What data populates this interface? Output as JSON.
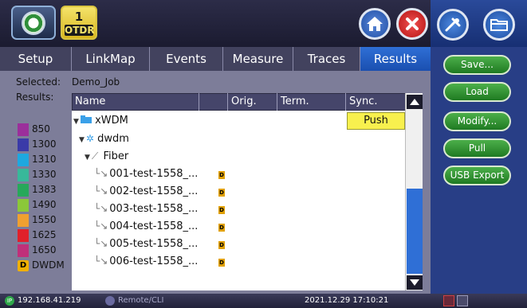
{
  "header": {
    "otdr_number": "1",
    "otdr_label": "OTDR"
  },
  "tabs": [
    {
      "label": "Setup"
    },
    {
      "label": "LinkMap"
    },
    {
      "label": "Events"
    },
    {
      "label": "Measure"
    },
    {
      "label": "Traces"
    },
    {
      "label": "Results",
      "active": true
    }
  ],
  "info": {
    "selected_label": "Selected:",
    "selected_value": "Demo_Job",
    "results_label": "Results:"
  },
  "legend": [
    {
      "label": "850",
      "color": "#9b2f9b"
    },
    {
      "label": "1300",
      "color": "#3a3aa8"
    },
    {
      "label": "1310",
      "color": "#1ea8e0"
    },
    {
      "label": "1330",
      "color": "#38b89a"
    },
    {
      "label": "1383",
      "color": "#27a85a"
    },
    {
      "label": "1490",
      "color": "#8bc83a"
    },
    {
      "label": "1550",
      "color": "#f0a030"
    },
    {
      "label": "1625",
      "color": "#e0202a"
    },
    {
      "label": "1650",
      "color": "#c0307a"
    },
    {
      "label": "DWDM",
      "badge": "D"
    }
  ],
  "table": {
    "columns": [
      "Name",
      "Orig.",
      "Term.",
      "Sync."
    ],
    "push_label": "Push",
    "rows": [
      {
        "label": "xWDM"
      },
      {
        "label": "dwdm"
      },
      {
        "label": "Fiber"
      },
      {
        "label": "001-test-1558_...",
        "badge": "D"
      },
      {
        "label": "002-test-1558_...",
        "badge": "D"
      },
      {
        "label": "003-test-1558_...",
        "badge": "D"
      },
      {
        "label": "004-test-1558_...",
        "badge": "D"
      },
      {
        "label": "005-test-1558_...",
        "badge": "D"
      },
      {
        "label": "006-test-1558_...",
        "badge": "D"
      }
    ]
  },
  "sidebar": {
    "buttons": [
      {
        "label": "Save..."
      },
      {
        "label": "Load"
      },
      {
        "label": "Modify..."
      },
      {
        "label": "Pull"
      },
      {
        "label": "USB Export"
      }
    ]
  },
  "status": {
    "ip": "192.168.41.219",
    "remote": "Remote/CLI",
    "datetime": "2021.12.29  17:10:21"
  },
  "icons": {
    "logo": "otdr-logo-icon",
    "home": "home-icon",
    "close": "close-icon",
    "tool": "tool-icon",
    "folder": "folder-icon"
  }
}
